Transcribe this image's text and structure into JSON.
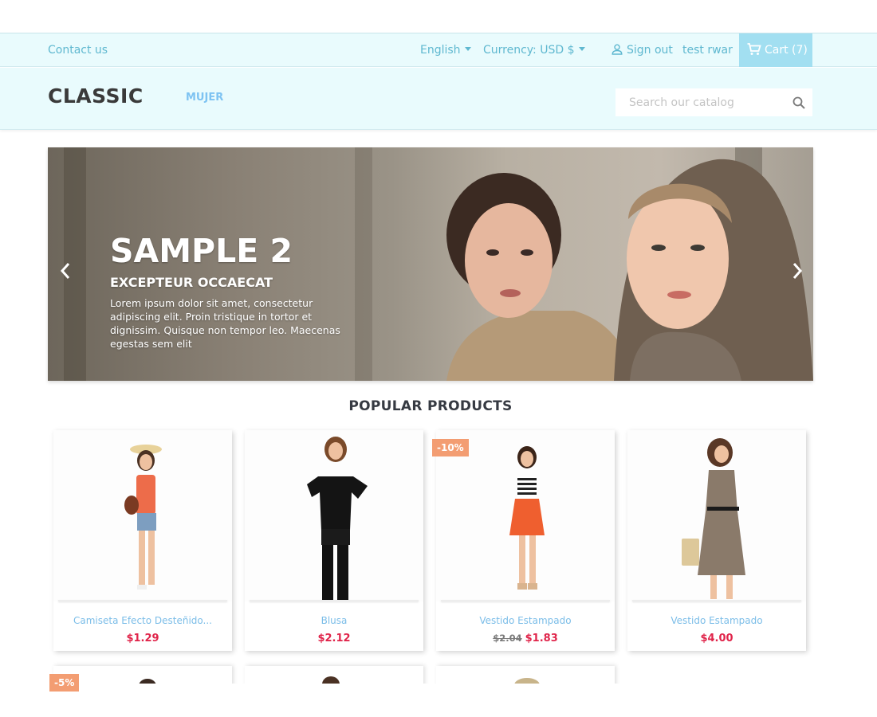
{
  "topbar": {
    "contact": "Contact us",
    "language": "English",
    "currency": "Currency: USD $",
    "signout": "Sign out",
    "user": "test rwar",
    "cart": "Cart (7)"
  },
  "header": {
    "logo": "CLASSIC",
    "menu": [
      "MUJER"
    ],
    "search_placeholder": "Search our catalog"
  },
  "slider": {
    "title": "SAMPLE 2",
    "subtitle": "EXCEPTEUR OCCAECAT",
    "text": "Lorem ipsum dolor sit amet, consectetur adipiscing elit. Proin tristique in tortor et dignissim. Quisque non tempor leo. Maecenas egestas sem elit"
  },
  "section_title": "POPULAR PRODUCTS",
  "products": [
    {
      "name": "Camiseta Efecto Desteñido...",
      "price": "$1.29",
      "old_price": "",
      "badge": ""
    },
    {
      "name": "Blusa",
      "price": "$2.12",
      "old_price": "",
      "badge": ""
    },
    {
      "name": "Vestido Estampado",
      "price": "$1.83",
      "old_price": "$2.04",
      "badge": "-10%"
    },
    {
      "name": "Vestido Estampado",
      "price": "$4.00",
      "old_price": "",
      "badge": ""
    }
  ],
  "partial_row": {
    "badge": "-5%"
  },
  "colors": {
    "accent": "#5fb8d0",
    "header_bg": "#e9fbfd",
    "cart_bg": "#a2dff1",
    "price": "#e0244a",
    "badge": "#f39d72",
    "product_name": "#7bbde8"
  },
  "icons": [
    "caret-down-icon",
    "user-icon",
    "cart-icon",
    "search-icon",
    "chevron-left-icon",
    "chevron-right-icon"
  ]
}
